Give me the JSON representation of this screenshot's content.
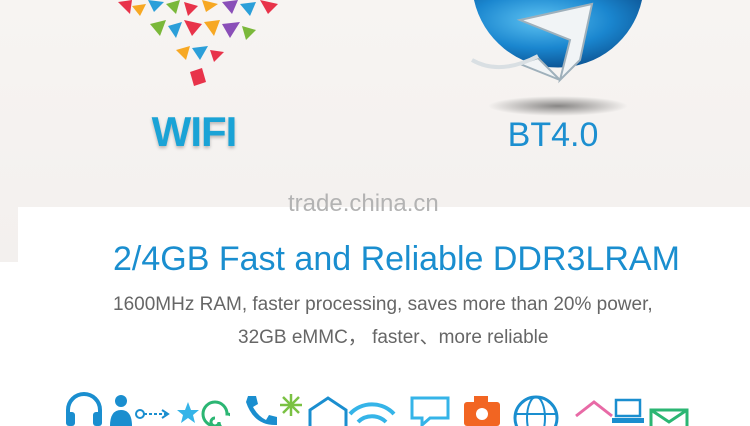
{
  "features": {
    "wifi": {
      "label": "WIFI",
      "icon": "wifi-signal-icon"
    },
    "bluetooth": {
      "label": "BT4.0",
      "icon": "bluetooth-logo-icon"
    }
  },
  "watermark": "trade.china.cn",
  "ram": {
    "headline": "2/4GB Fast and Reliable DDR3LRAM",
    "line1": "1600MHz RAM, faster processing, saves more than 20% power,",
    "line2": "32GB eMMC， faster、more reliable"
  },
  "colors": {
    "accent_blue": "#1a8ecf",
    "wifi_blue": "#1aa3d6",
    "body_text": "#666666",
    "watermark": "#b3b3b3"
  },
  "app_icons": [
    "headphones-icon",
    "user-icon",
    "key-icon",
    "star-icon",
    "spiral-icon",
    "phone-icon",
    "sparkle-icon",
    "envelope-icon",
    "wifi-icon",
    "chat-bubble-icon",
    "camera-icon",
    "globe-icon",
    "house-icon",
    "laptop-icon",
    "mail-icon"
  ]
}
